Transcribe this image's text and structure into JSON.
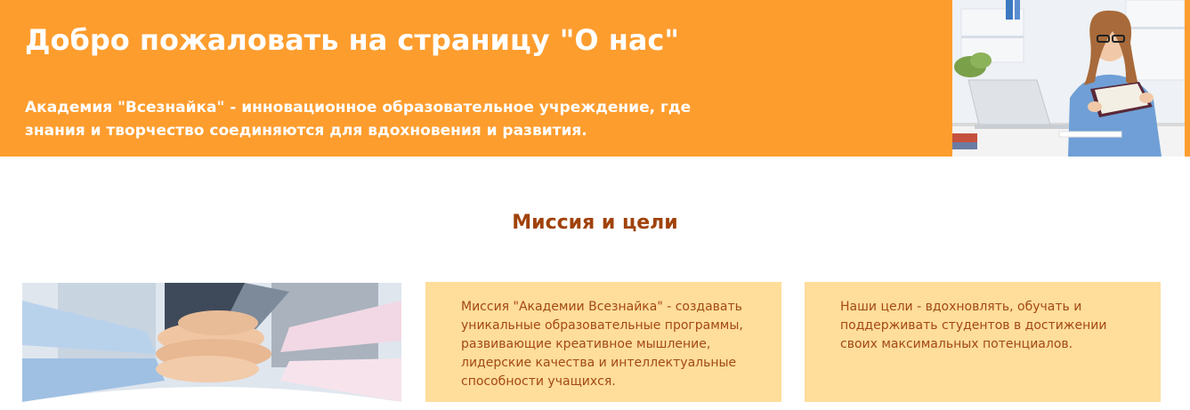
{
  "hero": {
    "title": "Добро пожаловать на страницу \"О нас\"",
    "subtitle": "Академия \"Всезнайка\" - инновационное образовательное учреждение, где знания и творчество соединяются для вдохновения и развития.",
    "background_color": "#fd9d2e"
  },
  "mission_section": {
    "title": "Миссия и цели",
    "title_color": "#a0420a",
    "mission_text": "Миссия \"Академии Всезнайка\" - создавать уникальные образовательные программы, развивающие креативное мышление, лидерские качества и интеллектуальные способности учащихся.",
    "goals_text": "Наши цели - вдохновлять, обучать и поддерживать студентов в достижении своих максимальных потенциалов.",
    "card_color": "#ffdd9b",
    "card_text_color": "#a34913"
  }
}
